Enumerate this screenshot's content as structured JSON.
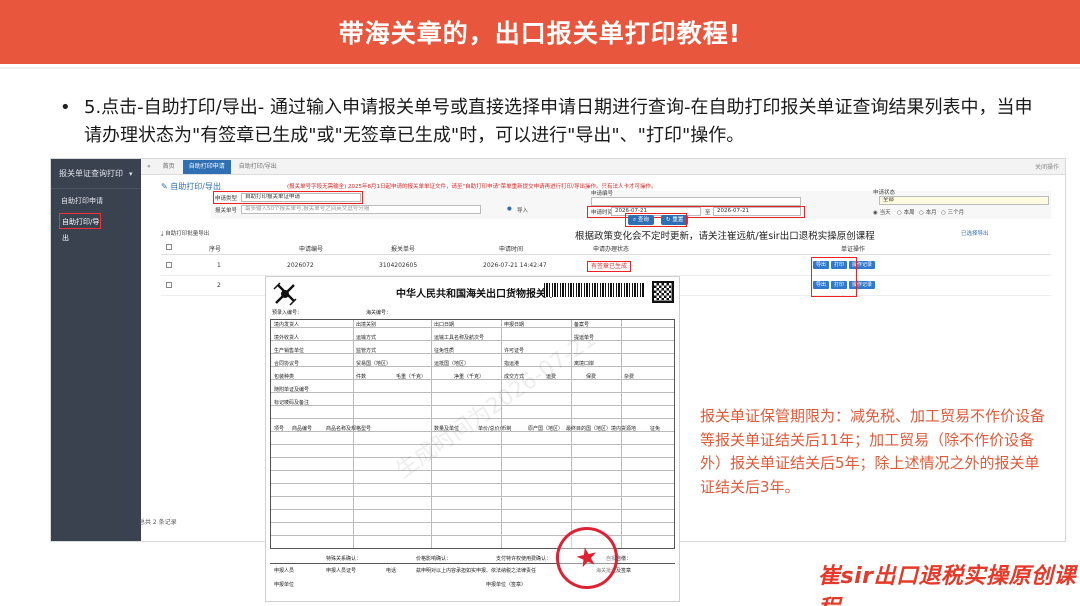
{
  "banner": {
    "title": "带海关章的，出口报关单打印教程!"
  },
  "bullet": "•",
  "instruction": "5.点击-自助打印/导出- 通过输入申请报关单号或直接选择申请日期进行查询-在自助打印报关单证查询结果列表中，当申请办理状态为\"有签章已生成\"或\"无签章已生成\"时，可以进行\"导出\"、\"打印\"操作。",
  "app": {
    "sidebar": {
      "header": "报关单证查询打印",
      "items": [
        {
          "label": "自助打印申请"
        },
        {
          "label": "自助打印/导出"
        }
      ]
    },
    "tabs": {
      "items": [
        "首页",
        "自助打印申请",
        "自助打印/导出"
      ],
      "close_all": "关闭操作"
    },
    "breadcrumb": "自助打印/导出",
    "notice": "(报关单号字段无需输全)   2025年8月1日起申请的报关单单证文件，请至\"自助打印申请\"菜单重新提交申请再进行打印/导出操作。只有法人卡才可操作。",
    "form": {
      "type_label": "申请类型",
      "type_value": "自助打印报关单证申请",
      "no_label": "报关单号",
      "no_placeholder": "最多输入50个报关单号,报关单号之间英文逗号分隔",
      "import_label": "导入",
      "apply_no_label": "申请编号",
      "date_label": "申请时间",
      "date_from": "2026-07-21",
      "date_to_label": "至",
      "date_to": "2026-07-21",
      "status_label": "申请状态",
      "status_value": "全部",
      "range_options": [
        "当天",
        "本周",
        "本月",
        "三个月"
      ],
      "query_button": "查询",
      "reset_button": "重置"
    },
    "toolbar": {
      "batch_export": "自助打印批量导出",
      "export_all": "已选择导出"
    },
    "overlay_note": "根据政策变化会不定时更新，请关注崔远航/崔sir出口退税实操原创课程",
    "table": {
      "headers": [
        "序号",
        "申请编号",
        "报关单号",
        "申请时间",
        "申请办理状态",
        "单证操作"
      ],
      "rows": [
        {
          "index": "1",
          "apply_no": "2026072",
          "decl_no": "3104202605",
          "time": "2026-07-21 14:42:47",
          "status": "有签章已生成",
          "ops": [
            "导出",
            "打印",
            "操作记录"
          ]
        },
        {
          "index": "2",
          "apply_no": "",
          "decl_no": "",
          "time": "",
          "status": "",
          "ops": [
            "导出",
            "打印",
            "操作记录"
          ]
        }
      ],
      "footer": "总共 2 条记录"
    }
  },
  "document": {
    "title": "中华人民共和国海关出口货物报关单",
    "barcode_caption": "",
    "watermark": "生成时间为2026-07-21",
    "fields": [
      "预录入编号：",
      "海关编号：",
      "境内发货人",
      "出境关别",
      "出口日期",
      "申报日期",
      "备案号",
      "境外收货人",
      "运输方式",
      "运输工具名称及航次号",
      "提运单号",
      "生产销售单位",
      "监管方式",
      "征免性质",
      "许可证号",
      "合同协议号",
      "贸易国（地区）",
      "运抵国（地区）",
      "指运港",
      "离境口岸",
      "包装种类",
      "件数",
      "毛重（千克）",
      "净重（千克）",
      "成交方式",
      "运费",
      "保费",
      "杂费",
      "随附单证及编号",
      "标记唛码及备注",
      "项号",
      "商品编号",
      "商品名称及规格型号",
      "数量及单位",
      "单价/总价/币制",
      "原产国（地区）",
      "最终目的国（地区）",
      "境内货源地",
      "征免",
      "特殊关系确认：",
      "价格影响确认：",
      "支付特许权使用费确认：",
      "自报自缴：",
      "申报人员",
      "申报人员证号",
      "电话",
      "兹申明对以上内容承担如实申报、依法纳税之法律责任",
      "海关批注及签章",
      "申报单位",
      "申报单位（签章）"
    ]
  },
  "note": "报关单证保管期限为：减免税、加工贸易不作价设备等报关单证结关后11年；加工贸易（除不作价设备外）报关单证结关后5年；除上述情况之外的报关单证结关后3年。",
  "brand": "崔sir出口退税实操原创课程"
}
